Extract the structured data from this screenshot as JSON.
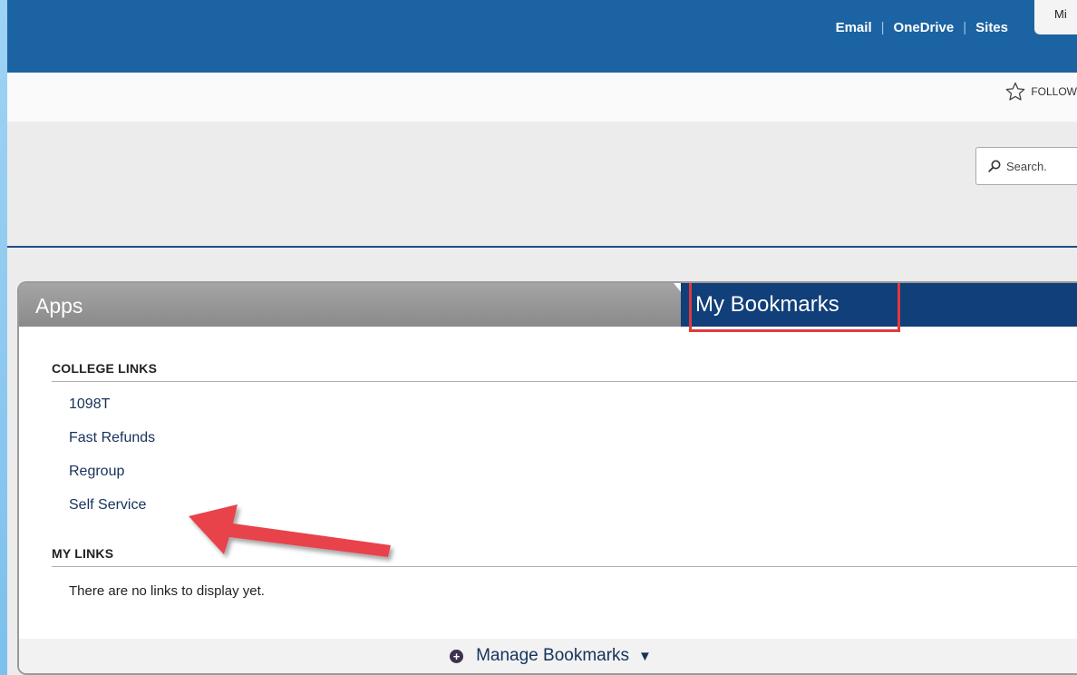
{
  "topnav": {
    "email": "Email",
    "onedrive": "OneDrive",
    "sites": "Sites",
    "separator": "|",
    "ms_tab": "Mi"
  },
  "follow": {
    "label": "FOLLOW",
    "icon": "star-icon"
  },
  "search": {
    "placeholder": "Search.",
    "icon": "search-icon"
  },
  "tabs": {
    "apps": "Apps",
    "bookmarks": "My Bookmarks"
  },
  "college_links": {
    "title": "COLLEGE LINKS",
    "items": [
      "1098T",
      "Fast Refunds",
      "Regroup",
      "Self Service"
    ]
  },
  "my_links": {
    "title": "MY LINKS",
    "empty": "There are no links to display yet."
  },
  "manage": {
    "label": "Manage Bookmarks",
    "plus": "+",
    "caret": "▼"
  },
  "colors": {
    "topbar": "#1b63a2",
    "bookmarks_tab": "#113f7a",
    "highlight": "#e0393d",
    "link": "#16325c"
  }
}
